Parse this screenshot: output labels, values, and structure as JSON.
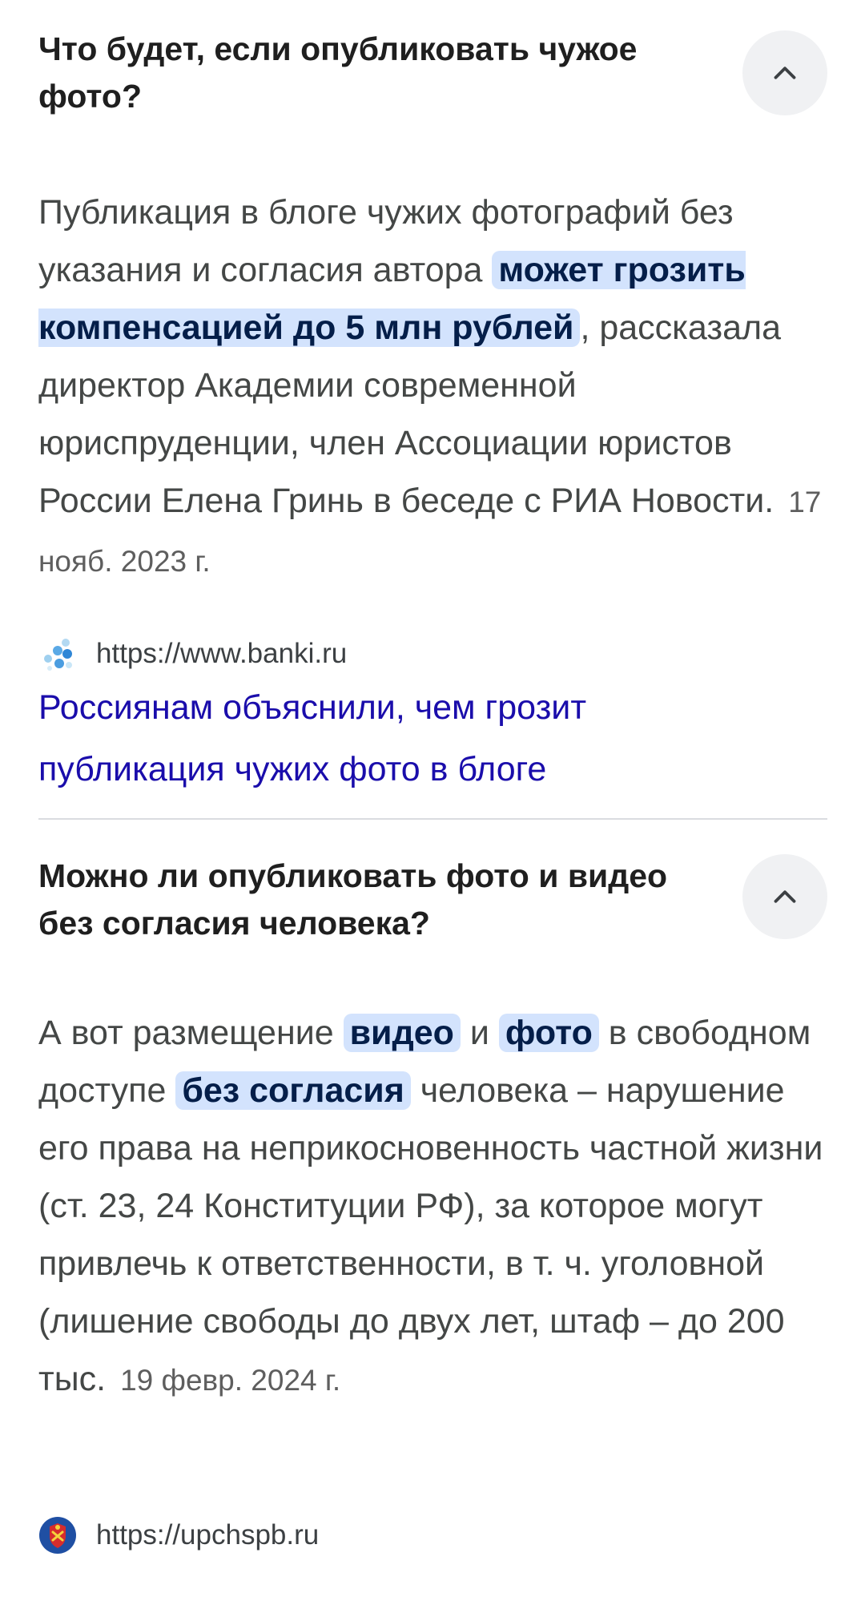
{
  "faq": [
    {
      "question": "Что будет, если опубликовать чужое фото?",
      "answer": {
        "text1": "Публикация в блоге чужих фотографий без указания и согласия автора ",
        "highlight1": "может грозить компенсацией до 5 млн рублей",
        "text2": ", рассказала директор Академии современной юриспруденции, член Ассоциации юристов России Елена Гринь в беседе с РИА Новости.",
        "date": "17 нояб. 2023 г."
      },
      "source_url": "https://www.banki.ru",
      "link_title": "Россиянам объяснили, чем грозит публикация чужих фото в блоге",
      "toggle_icon": "chevron-up-icon"
    },
    {
      "question": "Можно ли опубликовать фото и видео без согласия человека?",
      "answer": {
        "text1": "А вот размещение ",
        "highlight1": "видео",
        "text2": " и ",
        "highlight2": "фото",
        "text3": " в свободном доступе ",
        "highlight3": "без согласия",
        "text4": " человека – нарушение его права на неприкосновенность частной жизни (ст. 23, 24 Конституции РФ), за которое могут привлечь к ответственности, в т. ч. уголовной (лишение свободы до двух лет, штаф – до 200 тыс.",
        "date": "19 февр. 2024 г."
      },
      "source_url": "https://upchspb.ru",
      "toggle_icon": "chevron-up-icon"
    }
  ],
  "colors": {
    "highlight_bg": "#d3e3fd",
    "highlight_text": "#041e49",
    "link": "#1a0dab",
    "toggle_bg": "#f0f1f3"
  }
}
